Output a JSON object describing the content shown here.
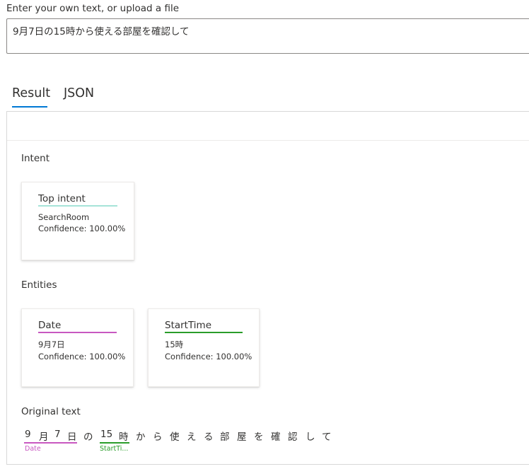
{
  "input": {
    "label": "Enter your own text, or upload a file",
    "value": "9月7日の15時から使える部屋を確認して"
  },
  "tabs": {
    "result": "Result",
    "json": "JSON"
  },
  "intent": {
    "section_title": "Intent",
    "card": {
      "title": "Top intent",
      "value": "SearchRoom",
      "confidence": "Confidence: 100.00%",
      "accent_color": "#a6e3d8"
    }
  },
  "entities": {
    "section_title": "Entities",
    "cards": [
      {
        "title": "Date",
        "value": "9月7日",
        "confidence": "Confidence: 100.00%",
        "accent_color": "#c858c0"
      },
      {
        "title": "StartTime",
        "value": "15時",
        "confidence": "Confidence: 100.00%",
        "accent_color": "#2a9d2a"
      }
    ]
  },
  "original_text": {
    "section_title": "Original text",
    "chars": [
      "9",
      "月",
      "7",
      "日",
      "の",
      "15",
      "時",
      "か",
      "ら",
      "使",
      "え",
      "る",
      "部",
      "屋",
      "を",
      "確",
      "認",
      "し",
      "て"
    ],
    "entity_labels": [
      {
        "label": "Date",
        "color": "#c858c0"
      },
      {
        "label": "StartTi...",
        "color": "#2a9d2a"
      }
    ]
  }
}
